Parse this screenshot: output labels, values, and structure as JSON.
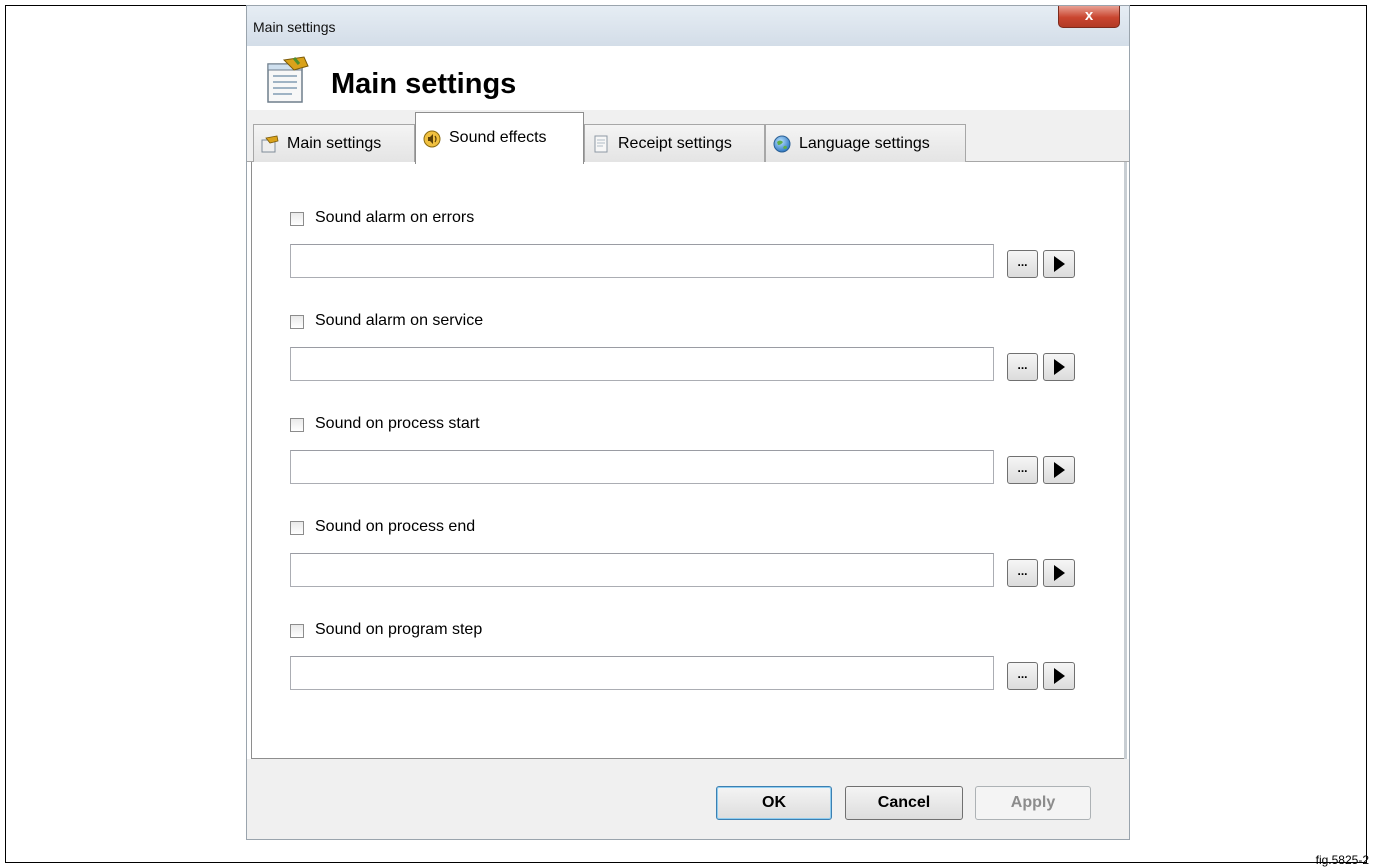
{
  "window": {
    "title": "Main settings",
    "close_label": "x"
  },
  "header": {
    "title": "Main settings",
    "icon": "settings-document-icon"
  },
  "tabs": [
    {
      "label": "Main settings",
      "icon": "settings-icon",
      "active": false
    },
    {
      "label": "Sound effects",
      "icon": "speaker-icon",
      "active": true
    },
    {
      "label": "Receipt settings",
      "icon": "receipt-icon",
      "active": false
    },
    {
      "label": "Language settings",
      "icon": "globe-icon",
      "active": false
    }
  ],
  "options": [
    {
      "label": "Sound alarm on errors",
      "checked": false,
      "path": ""
    },
    {
      "label": "Sound alarm on service",
      "checked": false,
      "path": ""
    },
    {
      "label": "Sound on process start",
      "checked": false,
      "path": ""
    },
    {
      "label": "Sound on process end",
      "checked": false,
      "path": ""
    },
    {
      "label": "Sound on program step",
      "checked": false,
      "path": ""
    }
  ],
  "browse_label": "...",
  "buttons": {
    "ok": "OK",
    "cancel": "Cancel",
    "apply": "Apply"
  },
  "figure_label": "fig.5825-2"
}
